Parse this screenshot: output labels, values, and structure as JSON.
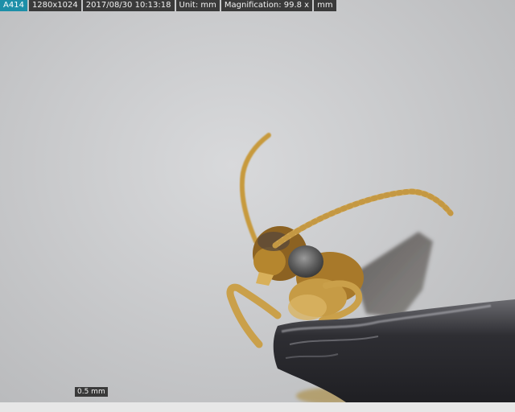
{
  "infobar": {
    "image_id": "A414",
    "resolution": "1280x1024",
    "datetime": "2017/08/30 10:13:18",
    "unit": "Unit: mm",
    "magnification": "Magnification:  99.8 x",
    "unit_button": "mm"
  },
  "scale_bar": {
    "label": "0.5 mm"
  },
  "colors": {
    "id_badge": "#1d8fa8",
    "info_bg": "#3a3a3a",
    "background": "#c9cacc",
    "insect_body": "#b8862a",
    "rock": "#2c2c30"
  }
}
